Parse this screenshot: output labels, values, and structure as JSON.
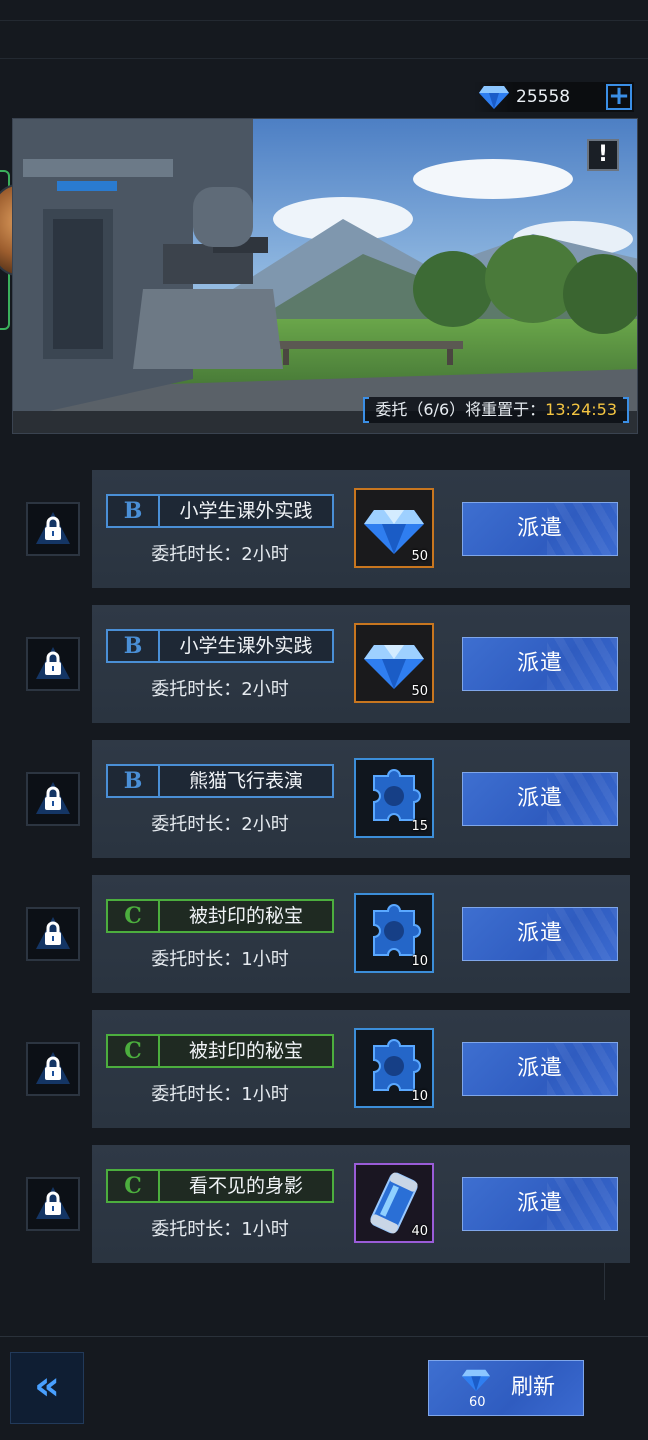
{
  "currency": {
    "icon": "diamond-icon",
    "amount": "25558",
    "add_label": "+"
  },
  "banner": {
    "alert_label": "!",
    "reset_prefix": "委托（6/6）将重置于：",
    "reset_time": "13:24:53"
  },
  "tasks": [
    {
      "grade": "B",
      "name": "小学生课外实践",
      "duration": "委托时长：2小时",
      "reward_icon": "diamond-icon",
      "reward_qty": "50",
      "dispatch_label": "派遣"
    },
    {
      "grade": "B",
      "name": "小学生课外实践",
      "duration": "委托时长：2小时",
      "reward_icon": "diamond-icon",
      "reward_qty": "50",
      "dispatch_label": "派遣"
    },
    {
      "grade": "B",
      "name": "熊猫飞行表演",
      "duration": "委托时长：2小时",
      "reward_icon": "puzzle-chip-icon",
      "reward_qty": "15",
      "dispatch_label": "派遣"
    },
    {
      "grade": "C",
      "name": "被封印的秘宝",
      "duration": "委托时长：1小时",
      "reward_icon": "puzzle-chip-icon",
      "reward_qty": "10",
      "dispatch_label": "派遣"
    },
    {
      "grade": "C",
      "name": "被封印的秘宝",
      "duration": "委托时长：1小时",
      "reward_icon": "puzzle-chip-icon",
      "reward_qty": "10",
      "dispatch_label": "派遣"
    },
    {
      "grade": "C",
      "name": "看不见的身影",
      "duration": "委托时长：1小时",
      "reward_icon": "energy-canister-icon",
      "reward_qty": "40",
      "dispatch_label": "派遣"
    }
  ],
  "bottom": {
    "back_label": "«",
    "refresh_label": "刷新",
    "refresh_cost": "60"
  },
  "colors": {
    "grade_b": "#4a8fd6",
    "grade_c": "#4cae3e",
    "timer": "#f4c542",
    "button": "#3466c8"
  }
}
